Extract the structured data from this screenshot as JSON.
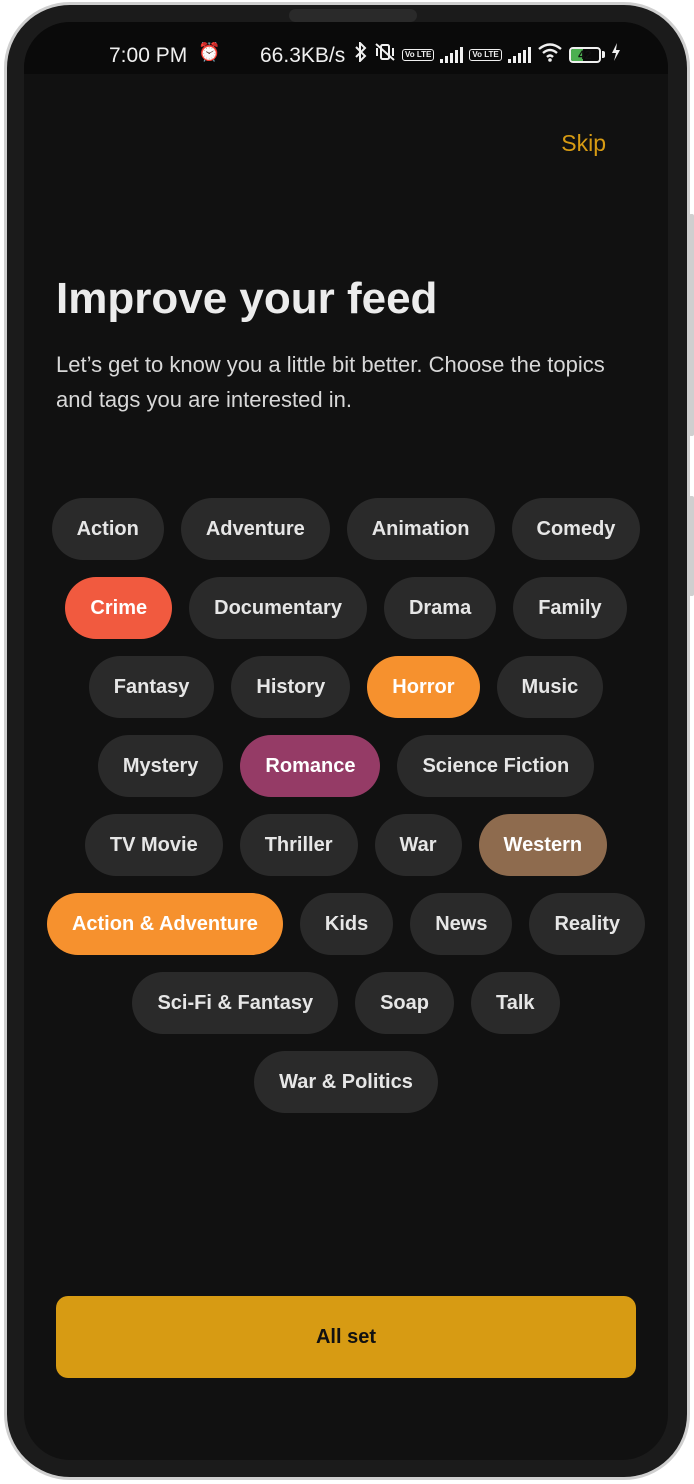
{
  "status_bar": {
    "time": "7:00 PM",
    "alarm_icon": "alarm-icon",
    "network_speed": "66.3KB/s",
    "volte_label": "Vo LTE",
    "battery_level": "42",
    "battery_percent": 42,
    "battery_color": "#4caf50"
  },
  "header": {
    "skip_label": "Skip",
    "title": "Improve your feed",
    "subtitle": "Let’s get to know you a little bit better. Choose the topics and tags you are interested in."
  },
  "genres": [
    {
      "label": "Action",
      "selected": false,
      "color": "#2a2a2a"
    },
    {
      "label": "Adventure",
      "selected": false,
      "color": "#2a2a2a"
    },
    {
      "label": "Animation",
      "selected": false,
      "color": "#2a2a2a"
    },
    {
      "label": "Comedy",
      "selected": false,
      "color": "#2a2a2a"
    },
    {
      "label": "Crime",
      "selected": true,
      "color": "#f15a3f"
    },
    {
      "label": "Documentary",
      "selected": false,
      "color": "#2a2a2a"
    },
    {
      "label": "Drama",
      "selected": false,
      "color": "#2a2a2a"
    },
    {
      "label": "Family",
      "selected": false,
      "color": "#2a2a2a"
    },
    {
      "label": "Fantasy",
      "selected": false,
      "color": "#2a2a2a"
    },
    {
      "label": "History",
      "selected": false,
      "color": "#2a2a2a"
    },
    {
      "label": "Horror",
      "selected": true,
      "color": "#f6912e"
    },
    {
      "label": "Music",
      "selected": false,
      "color": "#2a2a2a"
    },
    {
      "label": "Mystery",
      "selected": false,
      "color": "#2a2a2a"
    },
    {
      "label": "Romance",
      "selected": true,
      "color": "#953b66"
    },
    {
      "label": "Science Fiction",
      "selected": false,
      "color": "#2a2a2a"
    },
    {
      "label": "TV Movie",
      "selected": false,
      "color": "#2a2a2a"
    },
    {
      "label": "Thriller",
      "selected": false,
      "color": "#2a2a2a"
    },
    {
      "label": "War",
      "selected": false,
      "color": "#2a2a2a"
    },
    {
      "label": "Western",
      "selected": true,
      "color": "#8e6b4e"
    },
    {
      "label": "Action & Adventure",
      "selected": true,
      "color": "#f6912e"
    },
    {
      "label": "Kids",
      "selected": false,
      "color": "#2a2a2a"
    },
    {
      "label": "News",
      "selected": false,
      "color": "#2a2a2a"
    },
    {
      "label": "Reality",
      "selected": false,
      "color": "#2a2a2a"
    },
    {
      "label": "Sci-Fi & Fantasy",
      "selected": false,
      "color": "#2a2a2a"
    },
    {
      "label": "Soap",
      "selected": false,
      "color": "#2a2a2a"
    },
    {
      "label": "Talk",
      "selected": false,
      "color": "#2a2a2a"
    },
    {
      "label": "War & Politics",
      "selected": false,
      "color": "#2a2a2a"
    }
  ],
  "footer": {
    "cta_label": "All set"
  },
  "colors": {
    "background": "#111111",
    "accent": "#d79b13",
    "chip_default": "#2a2a2a",
    "selected_text": "#ffffff"
  }
}
